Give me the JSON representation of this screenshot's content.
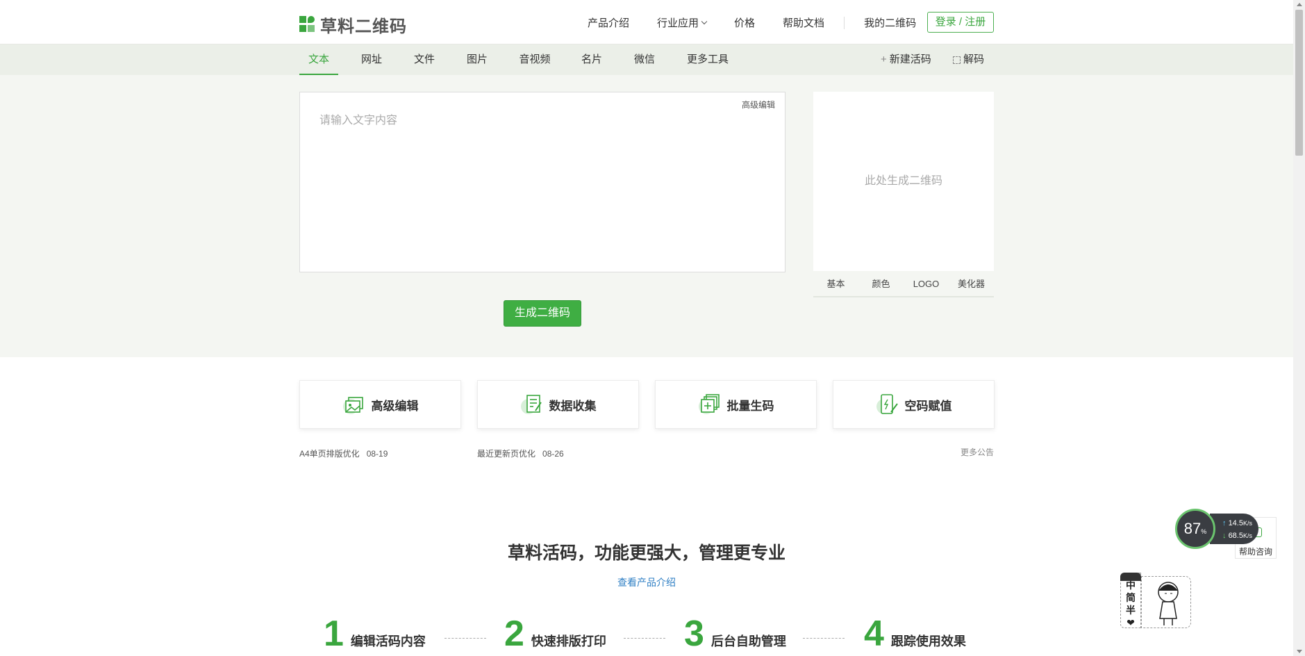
{
  "header": {
    "logo_text": "草料二维码",
    "nav": [
      {
        "label": "产品介绍"
      },
      {
        "label": "行业应用",
        "has_dropdown": true
      },
      {
        "label": "价格"
      },
      {
        "label": "帮助文档"
      },
      {
        "label": "我的二维码"
      }
    ],
    "login_label": "登录 / 注册"
  },
  "subnav": {
    "tabs": [
      "文本",
      "网址",
      "文件",
      "图片",
      "音视频",
      "名片",
      "微信",
      "更多工具"
    ],
    "active_tab": "文本",
    "new_live_code": "新建活码",
    "decode": "解码"
  },
  "editor": {
    "placeholder": "请输入文字内容",
    "advanced_edit": "高级编辑",
    "generate_button": "生成二维码"
  },
  "qr_preview": {
    "placeholder": "此处生成二维码",
    "tabs": [
      "基本",
      "颜色",
      "LOGO",
      "美化器"
    ]
  },
  "features": [
    {
      "label": "高级编辑",
      "icon": "image-edit-icon"
    },
    {
      "label": "数据收集",
      "icon": "form-edit-icon"
    },
    {
      "label": "批量生码",
      "icon": "batch-add-icon"
    },
    {
      "label": "空码赋值",
      "icon": "phone-assign-icon"
    }
  ],
  "notices": [
    {
      "text": "A4单页排版优化",
      "date": "08-19"
    },
    {
      "text": "最近更新页优化",
      "date": "08-26"
    }
  ],
  "more_notices": "更多公告",
  "headline": "草料活码，功能更强大，管理更专业",
  "view_intro": "查看产品介绍",
  "steps": [
    {
      "num": "1",
      "label": "编辑活码内容"
    },
    {
      "num": "2",
      "label": "快速排版打印"
    },
    {
      "num": "3",
      "label": "后台自助管理"
    },
    {
      "num": "4",
      "label": "跟踪使用效果"
    }
  ],
  "widgets": {
    "speed_percent": "87",
    "percent_sign": "%",
    "upload_speed": "14.5",
    "download_speed": "68.5",
    "speed_unit": "K/s",
    "help_consult": "帮助咨询",
    "ime_chars": [
      "中",
      "简",
      "半",
      "❤"
    ]
  },
  "colors": {
    "brand_green": "#3aa63e",
    "subnav_bg": "#ebefe8",
    "main_bg": "#f4f6f2",
    "link_blue": "#2f7fc4"
  }
}
